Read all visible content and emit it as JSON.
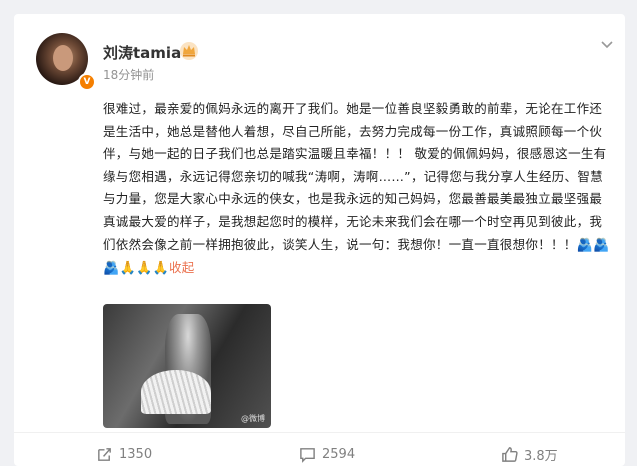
{
  "post": {
    "author": "刘涛tamia",
    "verified_badge": "V",
    "time": "18分钟前",
    "text": "很难过，最亲爱的佩妈永远的离开了我们。她是一位善良坚毅勇敢的前辈，无论在工作还是生活中，她总是替他人着想，尽自己所能，去努力完成每一份工作，真诚照顾每一个伙伴，与她一起的日子我们也总是踏实温暖且幸福！！！ 敬爱的佩佩妈妈，很感恩这一生有缘与您相遇，永远记得您亲切的喊我“涛啊，涛啊……”，记得您与我分享人生经历、智慧与力量，您是大家心中永远的侠女，也是我永远的知己妈妈，您最善最美最独立最坚强最真诚最大爱的样子，是我想起您时的模样，无论未来我们会在哪一个时空再见到彼此，我们依然会像之前一样拥抱彼此，谈笑人生，说一句：我想你！一直一直很想你！！！",
    "emojis": "🫂🫂🫂🙏🙏🙏",
    "collapse_label": "收起",
    "image_watermark": "@微博"
  },
  "actions": {
    "repost_count": "1350",
    "comment_count": "2594",
    "like_count": "3.8万"
  },
  "colors": {
    "accent": "#eb7350",
    "badge": "#f57f00",
    "muted": "#939393"
  },
  "icons": [
    "crown-icon",
    "verified-badge-icon",
    "more-icon",
    "repost-icon",
    "comment-icon",
    "like-icon"
  ]
}
